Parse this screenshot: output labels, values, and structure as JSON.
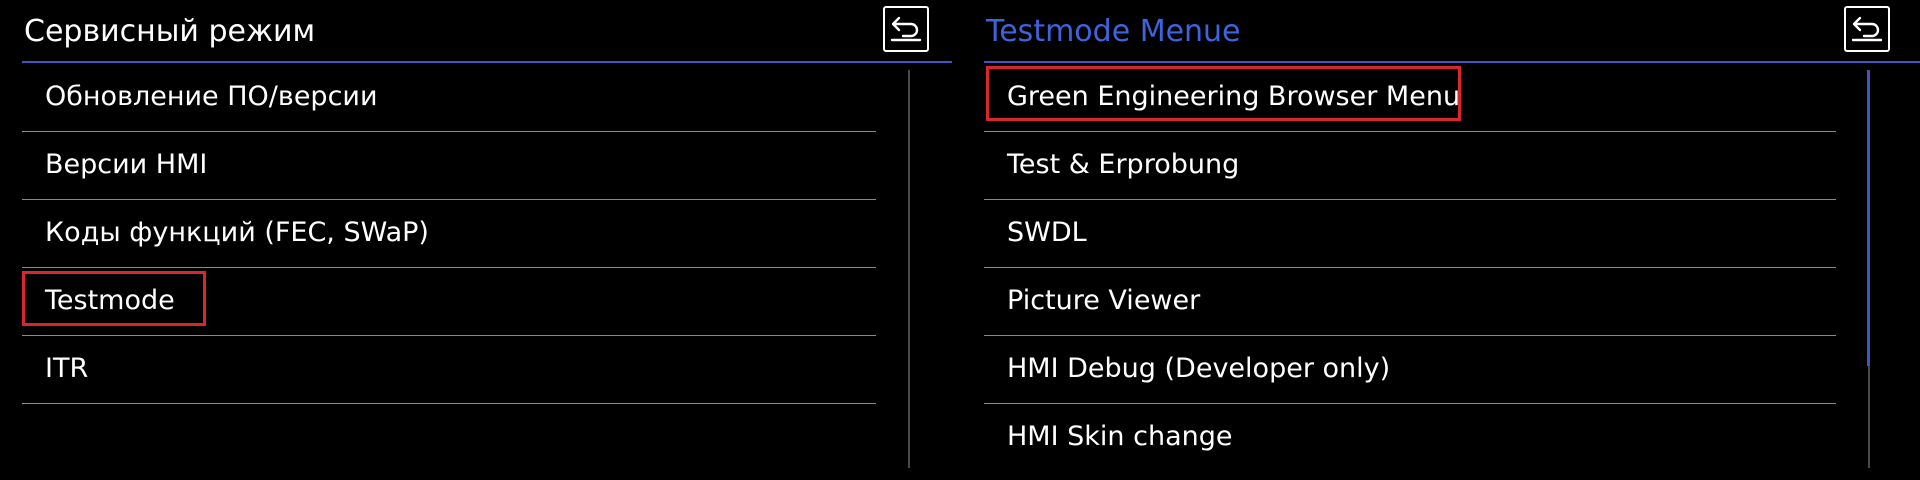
{
  "left_screen": {
    "title": "Сервисный режим",
    "back_icon": "back-arrow-icon",
    "items": [
      {
        "label": "Обновление ПО/версии",
        "highlighted": false
      },
      {
        "label": "Версии HMI",
        "highlighted": false
      },
      {
        "label": "Коды функций (FEC, SWaP)",
        "highlighted": false
      },
      {
        "label": "Testmode",
        "highlighted": true
      },
      {
        "label": "ITR",
        "highlighted": false
      }
    ]
  },
  "right_screen": {
    "title": "Testmode Menue",
    "back_icon": "back-arrow-icon",
    "items": [
      {
        "label": "Green Engineering Browser Menu",
        "highlighted": true
      },
      {
        "label": "Test & Erprobung",
        "highlighted": false
      },
      {
        "label": "SWDL",
        "highlighted": false
      },
      {
        "label": "Picture Viewer",
        "highlighted": false
      },
      {
        "label": "HMI Debug (Developer only)",
        "highlighted": false
      },
      {
        "label": "HMI Skin change",
        "highlighted": false
      }
    ]
  },
  "colors": {
    "background": "#000000",
    "text": "#ffffff",
    "accent_title": "#3d63dd",
    "header_rule": "#3d56c4",
    "divider": "#8a8a8a",
    "highlight": "#d8262f"
  }
}
